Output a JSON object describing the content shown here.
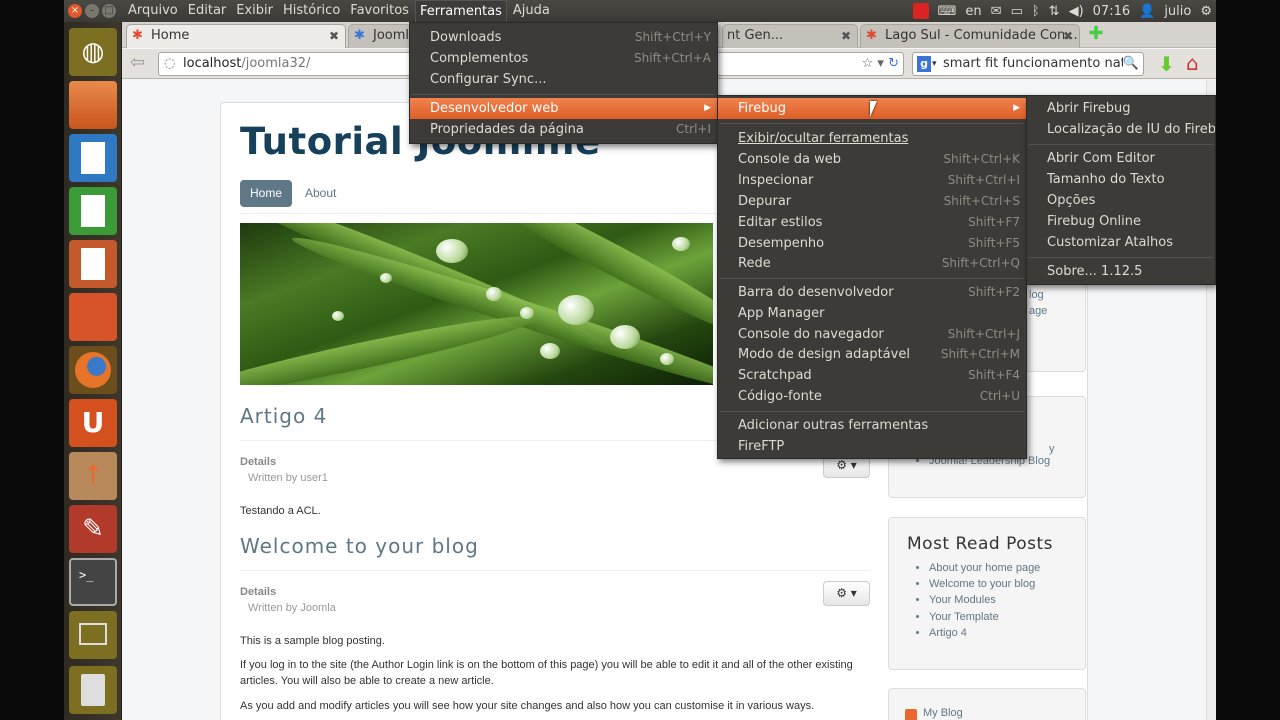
{
  "top_panel": {
    "menu": [
      "Arquivo",
      "Editar",
      "Exibir",
      "Histórico",
      "Favoritos",
      "Ferramentas",
      "Ajuda"
    ],
    "active_menu": "Ferramentas",
    "lang": "en",
    "time": "07:16",
    "user": "julio"
  },
  "tabs": [
    {
      "label": "Home"
    },
    {
      "label": "Joomla"
    },
    {
      "label": "nt Gen..."
    },
    {
      "label": "Lago Sul - Comunidade Con..."
    }
  ],
  "nav": {
    "url_host": "localhost",
    "url_path": "/joomla32/",
    "search_value": "smart fit funcionamento natal"
  },
  "site": {
    "title": "Tutorial Joomline",
    "nav_home": "Home",
    "nav_about": "About"
  },
  "articles": [
    {
      "title": "Artigo 4",
      "details": "Details",
      "written_by": "Written by user1",
      "body": [
        "Testando a ACL."
      ]
    },
    {
      "title": "Welcome to your blog",
      "details": "Details",
      "written_by": "Written by Joomla",
      "body": [
        "This is a sample blog posting.",
        "If you log in to the site (the Author Login link is on the bottom of this page) you will be able to edit it and all of the other existing articles. You will also be able to create a new article.",
        "As you add and modify articles you will see how your site changes and also how you can customise it in various ways."
      ]
    }
  ],
  "sidebar": {
    "module1_partial": [
      "log",
      "age"
    ],
    "module2_items": [
      "y",
      "Joomla! Leadership Blog"
    ],
    "most_read_title": "Most Read Posts",
    "most_read": [
      "About your home page",
      "Welcome to your blog",
      "Your Modules",
      "Your Template",
      "Artigo 4"
    ],
    "feed_label": "My Blog"
  },
  "menus": {
    "ferramentas": [
      {
        "label": "Downloads",
        "shortcut": "Shift+Ctrl+Y"
      },
      {
        "label": "Complementos",
        "shortcut": "Shift+Ctrl+A"
      },
      {
        "label": "Configurar Sync...",
        "shortcut": ""
      },
      {
        "label": "Desenvolvedor web",
        "shortcut": ""
      },
      {
        "label": "Propriedades da página",
        "shortcut": "Ctrl+I"
      }
    ],
    "desenvolvedor": [
      {
        "label": "Firebug",
        "shortcut": ""
      },
      {
        "label": "Exibir/ocultar ferramentas",
        "shortcut": ""
      },
      {
        "label": "Console da web",
        "shortcut": "Shift+Ctrl+K"
      },
      {
        "label": "Inspecionar",
        "shortcut": "Shift+Ctrl+I"
      },
      {
        "label": "Depurar",
        "shortcut": "Shift+Ctrl+S"
      },
      {
        "label": "Editar estilos",
        "shortcut": "Shift+F7"
      },
      {
        "label": "Desempenho",
        "shortcut": "Shift+F5"
      },
      {
        "label": "Rede",
        "shortcut": "Shift+Ctrl+Q"
      },
      {
        "label": "Barra do desenvolvedor",
        "shortcut": "Shift+F2"
      },
      {
        "label": "App Manager",
        "shortcut": ""
      },
      {
        "label": "Console do navegador",
        "shortcut": "Shift+Ctrl+J"
      },
      {
        "label": "Modo de design adaptável",
        "shortcut": "Shift+Ctrl+M"
      },
      {
        "label": "Scratchpad",
        "shortcut": "Shift+F4"
      },
      {
        "label": "Código-fonte",
        "shortcut": "Ctrl+U"
      },
      {
        "label": "Adicionar outras ferramentas",
        "shortcut": ""
      },
      {
        "label": "FireFTP",
        "shortcut": ""
      }
    ],
    "firebug": [
      {
        "label": "Abrir Firebug"
      },
      {
        "label": "Localização de IU do Firebug"
      },
      {
        "label": "Abrir Com Editor"
      },
      {
        "label": "Tamanho do Texto"
      },
      {
        "label": "Opções"
      },
      {
        "label": "Firebug Online"
      },
      {
        "label": "Customizar Atalhos"
      },
      {
        "label": "Sobre... 1.12.5"
      }
    ]
  },
  "colors": {
    "accent": "#e8692f",
    "joomla_blue": "#17405b",
    "link": "#5e7887"
  }
}
